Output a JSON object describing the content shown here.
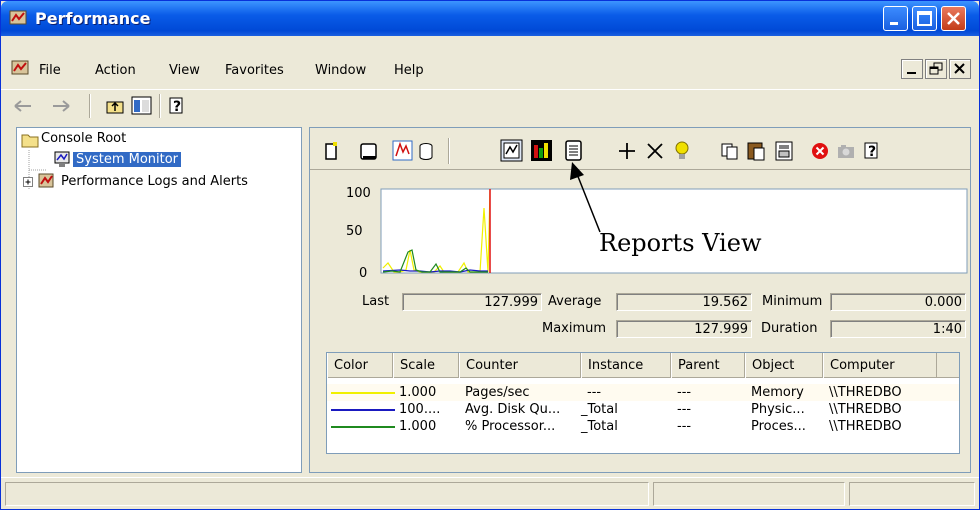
{
  "window": {
    "title": "Performance"
  },
  "menu": {
    "items": [
      "File",
      "Action",
      "View",
      "Favorites",
      "Window",
      "Help"
    ]
  },
  "tree": {
    "root": "Console Root",
    "items": [
      "System Monitor",
      "Performance Logs and Alerts"
    ]
  },
  "graph": {
    "y_labels": [
      "100",
      "50",
      "0"
    ]
  },
  "stats": {
    "last_label": "Last",
    "last_value": "127.999",
    "average_label": "Average",
    "average_value": "19.562",
    "minimum_label": "Minimum",
    "minimum_value": "0.000",
    "maximum_label": "Maximum",
    "maximum_value": "127.999",
    "duration_label": "Duration",
    "duration_value": "1:40"
  },
  "legend": {
    "headers": [
      "Color",
      "Scale",
      "Counter",
      "Instance",
      "Parent",
      "Object",
      "Computer"
    ],
    "rows": [
      {
        "color": "#f0f000",
        "scale": "1.000",
        "counter": "Pages/sec",
        "instance": "---",
        "parent": "---",
        "object": "Memory",
        "computer": "\\\\THREDBO"
      },
      {
        "color": "#1a1ac0",
        "scale": "100....",
        "counter": "Avg. Disk Qu...",
        "instance": "_Total",
        "parent": "---",
        "object": "Physic...",
        "computer": "\\\\THREDBO"
      },
      {
        "color": "#1f8a1f",
        "scale": "1.000",
        "counter": "% Processor...",
        "instance": "_Total",
        "parent": "---",
        "object": "Proces...",
        "computer": "\\\\THREDBO"
      }
    ]
  },
  "annotation": {
    "text": "Reports View"
  },
  "colors": {
    "titlebar": "#0a5ce8",
    "selection": "#316ac5",
    "graph_marker": "#e01010"
  }
}
